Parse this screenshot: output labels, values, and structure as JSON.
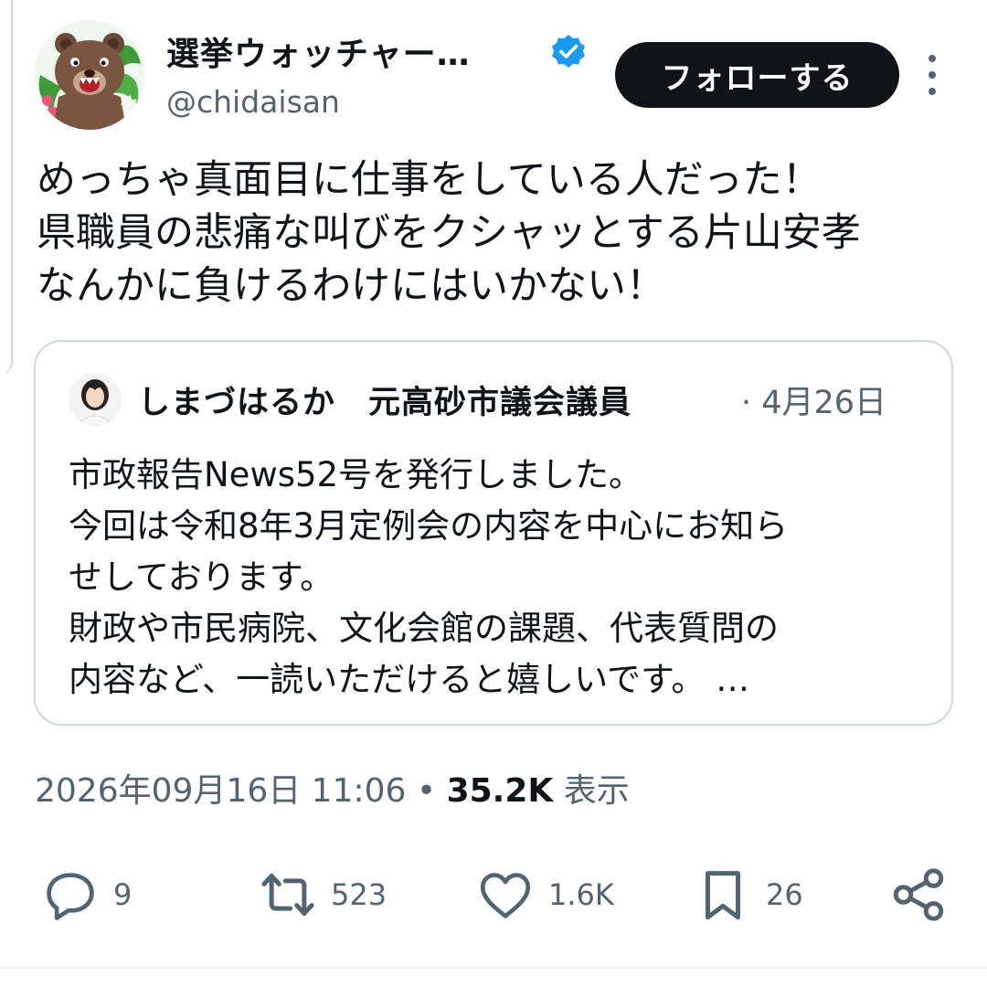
{
  "author": {
    "display_name": "選挙ウォッチャー…",
    "handle": "@chidaisan",
    "avatar_icon": "bear-avatar-icon",
    "verified_color": "#1d9bf0"
  },
  "follow_button_label": "フォローする",
  "tweet_text": "めっちゃ真面目に仕事をしている人だった！\n県職員の悲痛な叫びをクシャッとする片山安孝\nなんかに負けるわけにはいかない！",
  "quote": {
    "author_name": "しまづはるか　元高砂市議会議員",
    "date": "· 4月26日",
    "text": "市政報告News52号を発行しました。\n今回は令和8年3月定例会の内容を中心にお知ら\nせしております。\n財政や市民病院、文化会館の課題、代表質問の\n内容など、一読いただけると嬉しいです。 …"
  },
  "meta": {
    "datetime": "2026年09月16日 11:06",
    "separator": " • ",
    "views_count": "35.2K",
    "views_label": " 表示"
  },
  "actions": {
    "reply_count": "9",
    "retweet_count": "523",
    "like_count": "1.6K",
    "bookmark_count": "26"
  },
  "colors": {
    "text": "#0f1419",
    "secondary": "#536471",
    "border": "#cfd9de",
    "button_bg": "#0f1419"
  }
}
